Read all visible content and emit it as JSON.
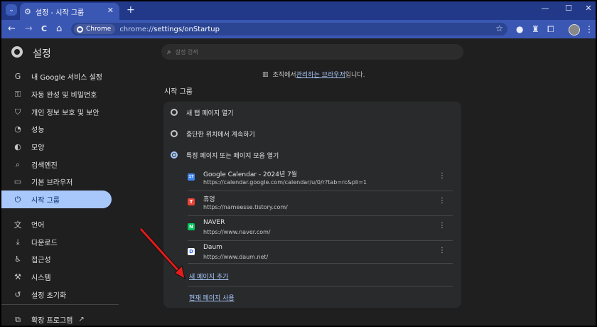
{
  "window": {
    "tab_title": "설정 - 시작 그룹",
    "tab_close": "✕",
    "new_tab": "+",
    "minimize": "—",
    "maximize": "☐",
    "close": "✕"
  },
  "toolbar": {
    "back": "←",
    "forward": "→",
    "reload": "C",
    "home": "⌂",
    "chip_label": "Chrome",
    "url_prefix": "chrome://",
    "url_path": "settings/onStartup"
  },
  "sidebar": {
    "title": "설정",
    "items": [
      {
        "icon": "G",
        "label": "내 Google 서비스 설정"
      },
      {
        "icon": "⚿",
        "label": "자동 완성 및 비밀번호"
      },
      {
        "icon": "⛉",
        "label": "개인 정보 보호 및 보안"
      },
      {
        "icon": "◔",
        "label": "성능"
      },
      {
        "icon": "◐",
        "label": "모양"
      },
      {
        "icon": "⌕",
        "label": "검색엔진"
      },
      {
        "icon": "▭",
        "label": "기본 브라우저"
      },
      {
        "icon": "⏻",
        "label": "시작 그룹"
      },
      {
        "icon": "文",
        "label": "언어"
      },
      {
        "icon": "⤓",
        "label": "다운로드"
      },
      {
        "icon": "♿",
        "label": "접근성"
      },
      {
        "icon": "⚒",
        "label": "시스템"
      },
      {
        "icon": "↺",
        "label": "설정 초기화"
      },
      {
        "icon": "⧉",
        "label": "확장 프로그램"
      }
    ],
    "active_index": 7
  },
  "search": {
    "placeholder": "설정 검색"
  },
  "managed": {
    "prefix": "조직에서 ",
    "link": "관리하는 브라우저",
    "suffix": "입니다."
  },
  "startup": {
    "section_title": "시작 그룹",
    "options": [
      "새 탭 페이지 열기",
      "중단한 위치에서 계속하기",
      "특정 페이지 또는 페이지 모음 열기"
    ],
    "selected_option": 2,
    "pages": [
      {
        "name": "Google Calendar - 2024년 7월",
        "url": "https://calendar.google.com/calendar/u/0/r?tab=rc&pli=1",
        "favicon": "17",
        "color": "#4285f4"
      },
      {
        "name": "휴엉",
        "url": "https://nameesse.tistory.com/",
        "favicon": "T",
        "color": "#eb4335"
      },
      {
        "name": "NAVER",
        "url": "https://www.naver.com/",
        "favicon": "N",
        "color": "#03c75a"
      },
      {
        "name": "Daum",
        "url": "https://www.daum.net/",
        "favicon": "D",
        "color": "#ffffff"
      }
    ],
    "add_page": "새 페이지 추가",
    "use_current": "현재 페이지 사용"
  }
}
